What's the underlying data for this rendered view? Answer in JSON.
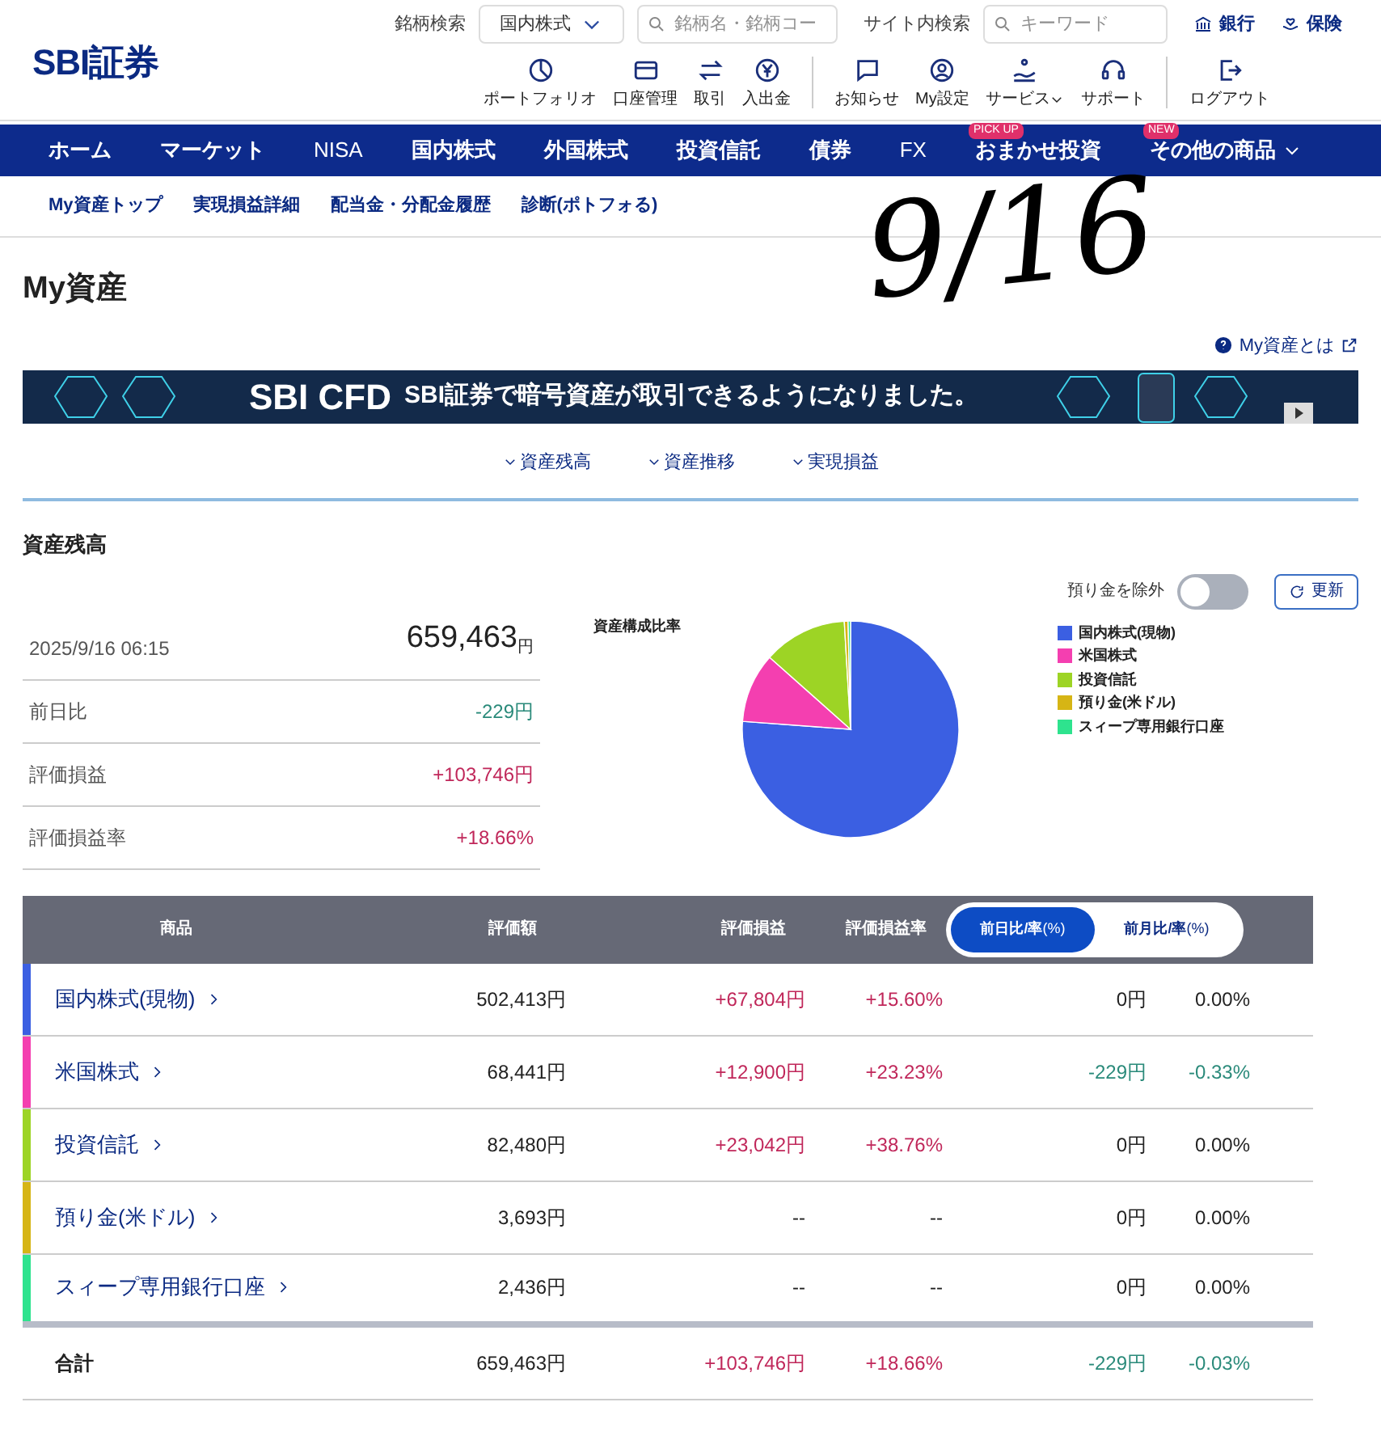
{
  "header": {
    "logo": "SBI証券",
    "stock_search_label": "銘柄検索",
    "market_select": "国内株式",
    "stock_search_placeholder": "銘柄名・銘柄コー",
    "site_search_label": "サイト内検索",
    "site_search_placeholder": "キーワード",
    "top_links": [
      {
        "kind": "bank",
        "label": "銀行"
      },
      {
        "kind": "insurance",
        "label": "保険"
      }
    ],
    "icons": [
      {
        "kind": "pie",
        "label": "ポートフォリオ"
      },
      {
        "kind": "card",
        "label": "口座管理"
      },
      {
        "kind": "swap",
        "label": "取引"
      },
      {
        "kind": "yen",
        "label": "入出金"
      },
      {
        "kind": "chat",
        "label": "お知らせ"
      },
      {
        "kind": "user",
        "label": "My設定"
      },
      {
        "kind": "service",
        "label": "サービス",
        "dropdown": true
      },
      {
        "kind": "headset",
        "label": "サポート"
      },
      {
        "kind": "logout",
        "label": "ログアウト"
      }
    ]
  },
  "nav": [
    {
      "label": "ホーム"
    },
    {
      "label": "マーケット"
    },
    {
      "label": "NISA"
    },
    {
      "label": "国内株式"
    },
    {
      "label": "外国株式"
    },
    {
      "label": "投資信託"
    },
    {
      "label": "債券"
    },
    {
      "label": "FX"
    },
    {
      "label": "おまかせ投資",
      "badge": "PICK UP"
    },
    {
      "label": "その他の商品",
      "badge": "NEW",
      "dropdown": true
    }
  ],
  "subnav": [
    "My資産トップ",
    "実現損益詳細",
    "配当金・分配金履歴",
    "診断(ポトフォる)"
  ],
  "annotation": "9/16",
  "page_title": "My資産",
  "help_link": "My資産とは",
  "banner": {
    "title": "SBI CFD",
    "text": "SBI証券で暗号資産が取引できるようになりました。"
  },
  "anchors": [
    "資産残高",
    "資産推移",
    "実現損益"
  ],
  "section_title": "資産残高",
  "exclude_deposit": {
    "label": "預り金を除外",
    "on": false
  },
  "refresh_button": "更新",
  "summary": {
    "datetime": "2025/9/16 06:15",
    "total": "659,463",
    "total_unit": "円",
    "rows": [
      {
        "label": "前日比",
        "value": "-229円",
        "color": "#2a8a7a"
      },
      {
        "label": "評価損益",
        "value": "+103,746円",
        "color": "#c0275a"
      },
      {
        "label": "評価損益率",
        "value": "+18.66%",
        "color": "#c0275a"
      }
    ]
  },
  "composition": {
    "title": "資産構成比率",
    "chart_data": {
      "type": "pie",
      "categories": [
        "国内株式(現物)",
        "米国株式",
        "投資信託",
        "預り金(米ドル)",
        "スィープ専用銀行口座"
      ],
      "values": [
        76.18,
        10.38,
        12.51,
        0.56,
        0.37
      ],
      "colors": [
        "#3b5fe2",
        "#f43fb0",
        "#9dd425",
        "#d6b515",
        "#2ee38e"
      ]
    }
  },
  "table": {
    "columns": [
      "商品",
      "評価額",
      "評価損益",
      "評価損益率"
    ],
    "toggle": [
      {
        "label": "前日比/率",
        "unit": "(%)",
        "selected": true
      },
      {
        "label": "前月比/率",
        "unit": "(%)",
        "selected": false
      }
    ],
    "rows": [
      {
        "name": "国内株式(現物)",
        "color": "#3b5fe2",
        "value": "502,413円",
        "gain": "+67,804円",
        "rate": "+15.60%",
        "day": {
          "text": "0円",
          "color": "#222222"
        },
        "day_rate": {
          "text": "0.00%",
          "color": "#222222"
        }
      },
      {
        "name": "米国株式",
        "color": "#f43fb0",
        "value": "68,441円",
        "gain": "+12,900円",
        "rate": "+23.23%",
        "day": {
          "text": "-229円",
          "color": "#2a8a7a"
        },
        "day_rate": {
          "text": "-0.33%",
          "color": "#2a8a7a"
        }
      },
      {
        "name": "投資信託",
        "color": "#9dd425",
        "value": "82,480円",
        "gain": "+23,042円",
        "rate": "+38.76%",
        "day": {
          "text": "0円",
          "color": "#222222"
        },
        "day_rate": {
          "text": "0.00%",
          "color": "#222222"
        }
      },
      {
        "name": "預り金(米ドル)",
        "color": "#d6b515",
        "value": "3,693円",
        "gain": "--",
        "rate": "--",
        "day": {
          "text": "0円",
          "color": "#222222"
        },
        "day_rate": {
          "text": "0.00%",
          "color": "#222222"
        }
      },
      {
        "name": "スィープ専用銀行口座",
        "color": "#2ee38e",
        "value": "2,436円",
        "gain": "--",
        "rate": "--",
        "day": {
          "text": "0円",
          "color": "#222222"
        },
        "day_rate": {
          "text": "0.00%",
          "color": "#222222"
        }
      }
    ],
    "total": {
      "label": "合計",
      "value": "659,463円",
      "gain": "+103,746円",
      "rate": "+18.66%",
      "day": {
        "text": "-229円",
        "color": "#2a8a7a"
      },
      "day_rate": {
        "text": "-0.03%",
        "color": "#2a8a7a"
      }
    }
  }
}
